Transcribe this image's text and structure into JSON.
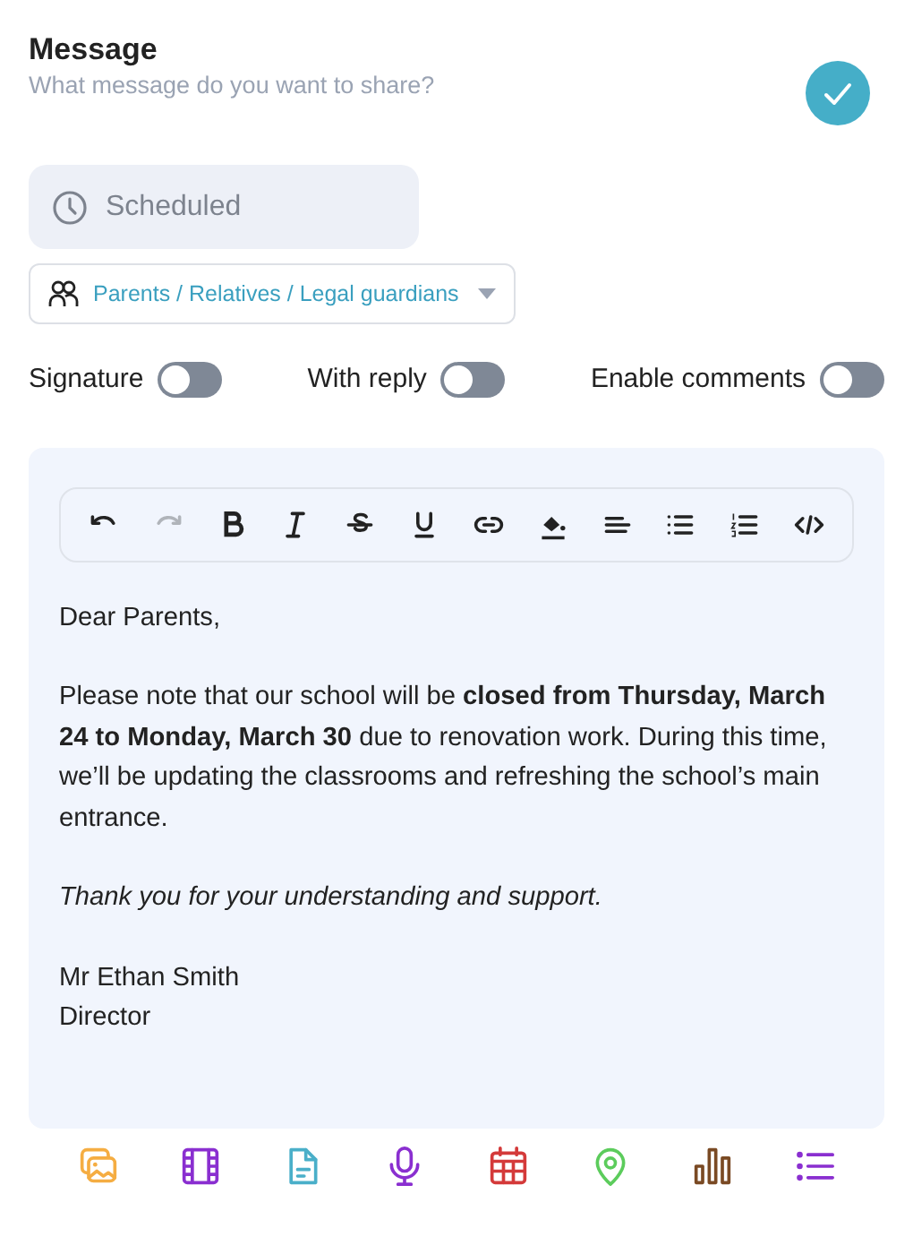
{
  "header": {
    "title": "Message",
    "subtitle": "What message do you want to share?",
    "confirmed": true
  },
  "schedule": {
    "label": "Scheduled"
  },
  "audience": {
    "value": "Parents / Relatives / Legal guardians"
  },
  "toggles": [
    {
      "label": "Signature",
      "on": false
    },
    {
      "label": "With reply",
      "on": false
    },
    {
      "label": "Enable comments",
      "on": false
    }
  ],
  "toolbar": [
    {
      "kind": "undo",
      "disabled": false
    },
    {
      "kind": "redo",
      "disabled": true
    },
    {
      "kind": "bold",
      "disabled": false
    },
    {
      "kind": "italic",
      "disabled": false
    },
    {
      "kind": "strike",
      "disabled": false
    },
    {
      "kind": "underline",
      "disabled": false
    },
    {
      "kind": "link",
      "disabled": false
    },
    {
      "kind": "fill",
      "disabled": false
    },
    {
      "kind": "align",
      "disabled": false
    },
    {
      "kind": "bullets",
      "disabled": false
    },
    {
      "kind": "numbers",
      "disabled": false
    },
    {
      "kind": "code",
      "disabled": false
    }
  ],
  "body": [
    {
      "text": "Dear Parents,",
      "italic": false
    },
    {
      "text": "Please note that our school will be **closed from Thursday, March 24 to Monday, March 30** due to renovation work. During this time, we’ll be updating the classrooms and refreshing the school’s main entrance.",
      "italic": false
    },
    {
      "text": "Thank you for your understanding and support.",
      "italic": true
    },
    {
      "lines": [
        "Mr Ethan Smith",
        "Director"
      ],
      "italic": false
    }
  ],
  "attachments": [
    {
      "kind": "images",
      "color": "#f5ad42"
    },
    {
      "kind": "video",
      "color": "#8a2fd0"
    },
    {
      "kind": "document",
      "color": "#4aafc9"
    },
    {
      "kind": "audio",
      "color": "#8a2fd0"
    },
    {
      "kind": "calendar",
      "color": "#d43a3a"
    },
    {
      "kind": "location",
      "color": "#5ccc5c"
    },
    {
      "kind": "poll",
      "color": "#7a4a24"
    },
    {
      "kind": "list",
      "color": "#8a2fd0"
    }
  ]
}
